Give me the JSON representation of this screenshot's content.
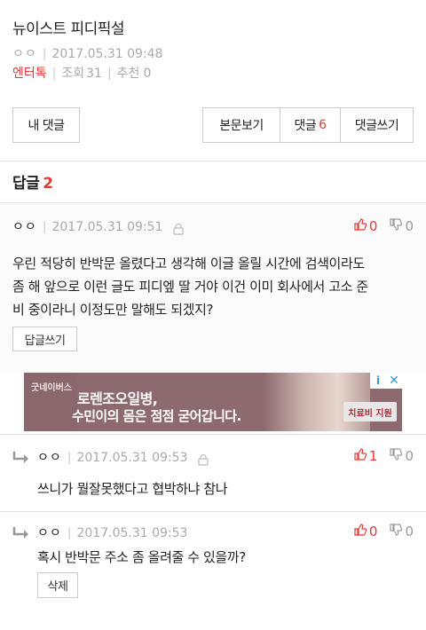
{
  "post": {
    "title": "뉴이스트 피디픽설",
    "author": "ㅇㅇ",
    "datetime": "2017.05.31 09:48",
    "category": "엔터톡",
    "views_label": "조회",
    "views": "31",
    "recommend_label": "추천",
    "recommend": "0"
  },
  "buttons": {
    "my_comments": "내 댓글",
    "view_post": "본문보기",
    "comments_label": "댓글",
    "comments_count": "6",
    "write_comment": "댓글쓰기"
  },
  "replies": {
    "label": "답글",
    "count": "2"
  },
  "comments": [
    {
      "nick": "ㅇㅇ",
      "datetime": "2017.05.31 09:51",
      "up": "0",
      "down": "0",
      "text_lines": [
        "우린 적당히 반박문 올렸다고 생각해 이글 올릴 시간에 검색이라도",
        "좀 해 앞으로 이런 글도 피디엪 딸 거야 이건 이미 회사에서 고소 준",
        "비 중이라니 이정도만 말해도 되겠지?"
      ],
      "reply_button": "답글쓰기"
    },
    {
      "nick": "ㅇㅇ",
      "datetime": "2017.05.31 09:53",
      "up": "1",
      "down": "0",
      "text": "쓰니가 뭘잘못했다고 협박하냐 참나"
    },
    {
      "nick": "ㅇㅇ",
      "datetime": "2017.05.31 09:53",
      "up": "0",
      "down": "0",
      "text": "혹시 반박문 주소 좀 올려줄 수 있을까?",
      "delete_button": "삭제"
    }
  ],
  "ad": {
    "brand": "굿네이버스",
    "line1": "로렌조오일병,",
    "line2": "수민이의 몸은 점점 굳어갑니다.",
    "cta": "치료비 지원",
    "info": "i",
    "close": "✕"
  },
  "colors": {
    "accent": "#e53935",
    "muted": "#aaaaaa",
    "ad_bg": "#8d6a6f"
  }
}
